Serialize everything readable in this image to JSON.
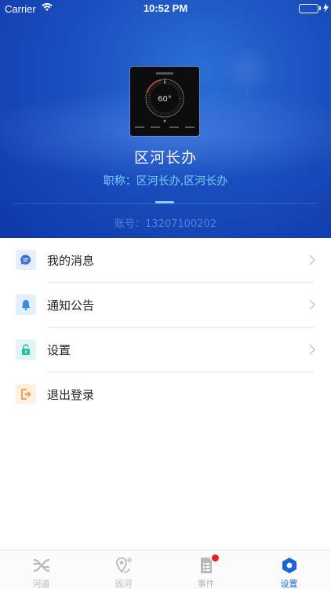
{
  "status_bar": {
    "carrier": "Carrier",
    "time": "10:52 PM"
  },
  "profile": {
    "name": "区河长办",
    "title": "职称：区河长办,区河长办",
    "account": "账号：13207100202",
    "avatar_reading": "60°"
  },
  "menu": {
    "items": [
      {
        "label": "我的消息",
        "icon": "message-icon",
        "color": "#3f6fd9",
        "bg": "#e6edfb",
        "chevron": true
      },
      {
        "label": "通知公告",
        "icon": "bell-icon",
        "color": "#2f8be6",
        "bg": "#e3f0fc",
        "chevron": true
      },
      {
        "label": "设置",
        "icon": "lock-icon",
        "color": "#2bbfa8",
        "bg": "#e1f6f2",
        "chevron": true
      },
      {
        "label": "退出登录",
        "icon": "logout-icon",
        "color": "#f29a3a",
        "bg": "#fdf1e2",
        "chevron": false
      }
    ]
  },
  "tabbar": {
    "tabs": [
      {
        "label": "河道",
        "icon": "river-icon",
        "active": false
      },
      {
        "label": "巡河",
        "icon": "map-pin-icon",
        "active": false
      },
      {
        "label": "事件",
        "icon": "document-list-icon",
        "active": false,
        "badge": true
      },
      {
        "label": "设置",
        "icon": "settings-hexagon-icon",
        "active": true
      }
    ]
  },
  "colors": {
    "header_blue": "#1a4fbf",
    "accent_blue": "#1e66d6",
    "badge_red": "#e8231b"
  }
}
